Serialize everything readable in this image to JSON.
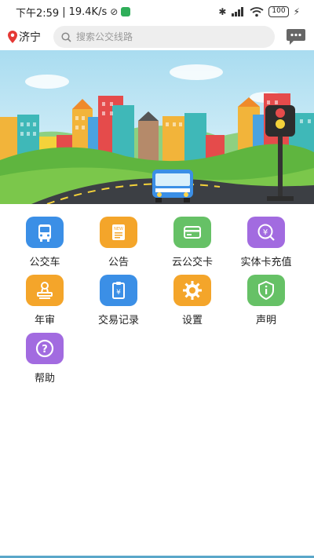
{
  "status_bar": {
    "time": "下午2:59",
    "network_speed": "19.4K/s",
    "battery": "100"
  },
  "header": {
    "city": "济宁",
    "search_placeholder": "搜索公交线路"
  },
  "grid": {
    "items": [
      {
        "label": "公交车",
        "color": "#3b8fe6",
        "icon": "bus-icon"
      },
      {
        "label": "公告",
        "color": "#f4a52a",
        "icon": "notice-icon"
      },
      {
        "label": "云公交卡",
        "color": "#66c166",
        "icon": "card-icon"
      },
      {
        "label": "实体卡充值",
        "color": "#a26be0",
        "icon": "recharge-icon"
      },
      {
        "label": "年审",
        "color": "#f4a52a",
        "icon": "stamp-icon"
      },
      {
        "label": "交易记录",
        "color": "#3b8fe6",
        "icon": "receipt-icon"
      },
      {
        "label": "设置",
        "color": "#f4a52a",
        "icon": "gear-icon"
      },
      {
        "label": "声明",
        "color": "#66c166",
        "icon": "shield-icon"
      },
      {
        "label": "帮助",
        "color": "#a26be0",
        "icon": "help-icon"
      }
    ]
  }
}
